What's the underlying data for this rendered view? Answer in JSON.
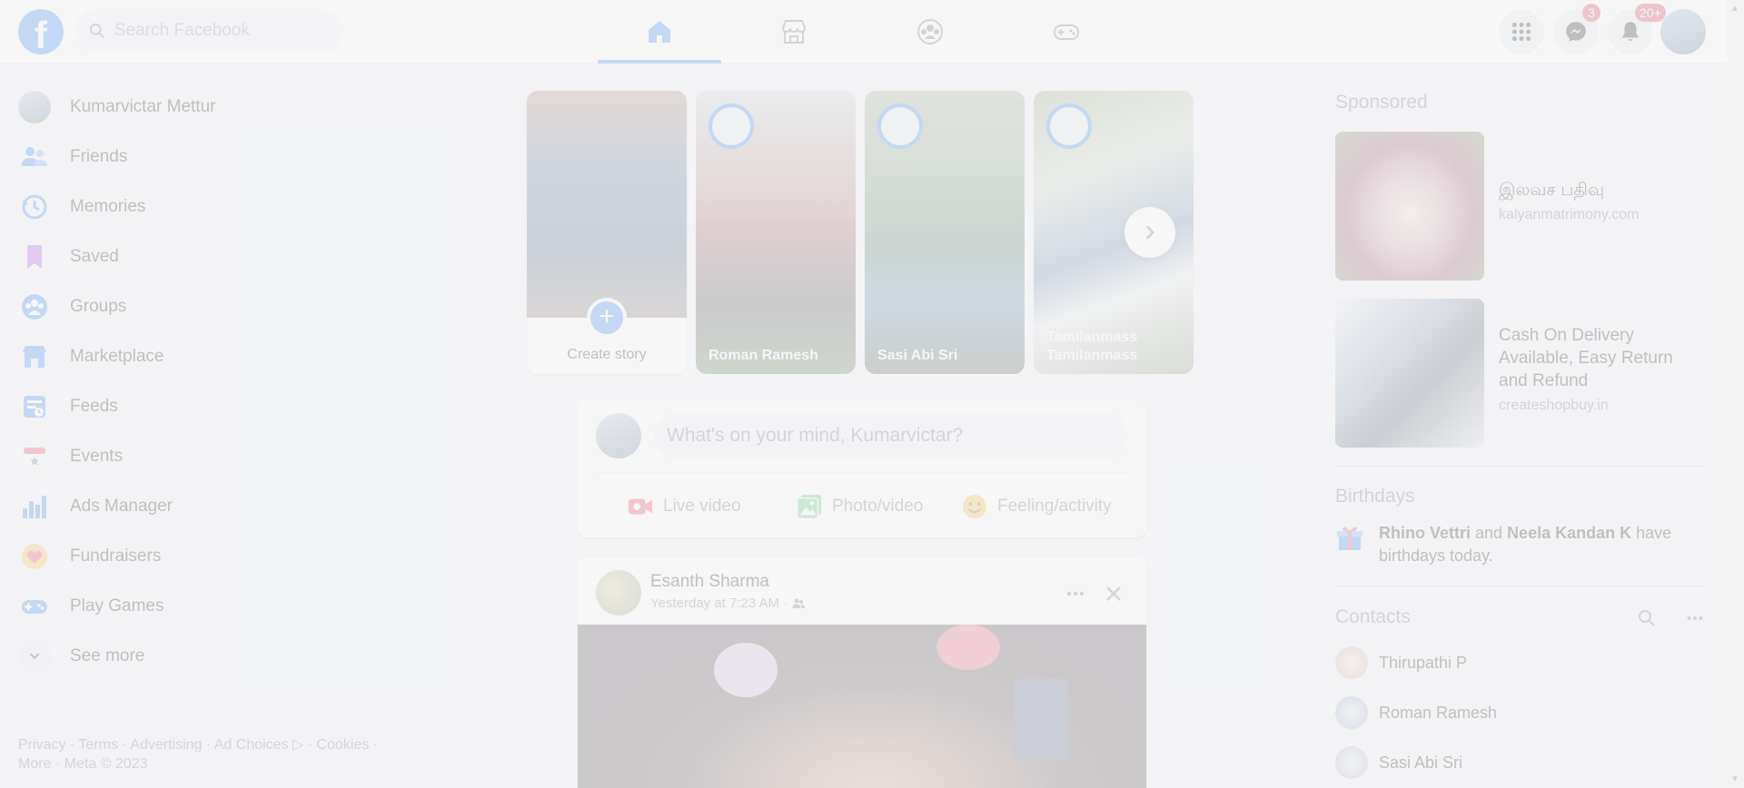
{
  "topbar": {
    "logo_letter": "f",
    "search_placeholder": "Search Facebook",
    "nav": [
      "home-icon",
      "marketplace-icon",
      "groups-icon",
      "gaming-icon"
    ],
    "messenger_badge": "3",
    "notifications_badge": "20+"
  },
  "sidebar": {
    "items": [
      {
        "label": "Kumarvictar Mettur",
        "icon": "avatar"
      },
      {
        "label": "Friends",
        "icon": "friends-icon"
      },
      {
        "label": "Memories",
        "icon": "memories-icon"
      },
      {
        "label": "Saved",
        "icon": "saved-icon"
      },
      {
        "label": "Groups",
        "icon": "groups-icon"
      },
      {
        "label": "Marketplace",
        "icon": "marketplace-icon"
      },
      {
        "label": "Feeds",
        "icon": "feeds-icon"
      },
      {
        "label": "Events",
        "icon": "events-icon"
      },
      {
        "label": "Ads Manager",
        "icon": "ads-manager-icon"
      },
      {
        "label": "Fundraisers",
        "icon": "fundraisers-icon"
      },
      {
        "label": "Play Games",
        "icon": "play-games-icon"
      },
      {
        "label": "See more",
        "icon": "chevron-down-icon"
      }
    ],
    "footer_line1": "Privacy · Terms · Advertising · Ad Choices ▷ · Cookies ·",
    "footer_line2": "More · Meta © 2023"
  },
  "stories": {
    "create_label": "Create story",
    "items": [
      {
        "name": "Roman Ramesh"
      },
      {
        "name": "Sasi Abi Sri"
      },
      {
        "name": "Tamilanmass Tamilanmass"
      }
    ]
  },
  "composer": {
    "placeholder": "What's on your mind, Kumarvictar?",
    "live_video": "Live video",
    "photo_video": "Photo/video",
    "feeling": "Feeling/activity"
  },
  "post": {
    "author": "Esanth Sharma",
    "time": "Yesterday at 7:23 AM · "
  },
  "right": {
    "sponsored_title": "Sponsored",
    "ads": [
      {
        "title": "இலவச பதிவு",
        "site": "kalyanmatrimony.com"
      },
      {
        "title": "Cash On Delivery Available, Easy Return and Refund",
        "site": "createshopbuy.in"
      }
    ],
    "birthdays_title": "Birthdays",
    "birthday_name1": "Rhino Vettri",
    "birthday_and": " and ",
    "birthday_name2": "Neela Kandan K",
    "birthday_rest": " have birthdays today.",
    "contacts_title": "Contacts",
    "contacts": [
      "Thirupathi P",
      "Roman Ramesh",
      "Sasi Abi Sri"
    ]
  },
  "colors": {
    "brand": "#1877f2",
    "badge": "#e41e3f",
    "live": "#f02849",
    "photo": "#45bd62",
    "feeling": "#f7b928"
  }
}
